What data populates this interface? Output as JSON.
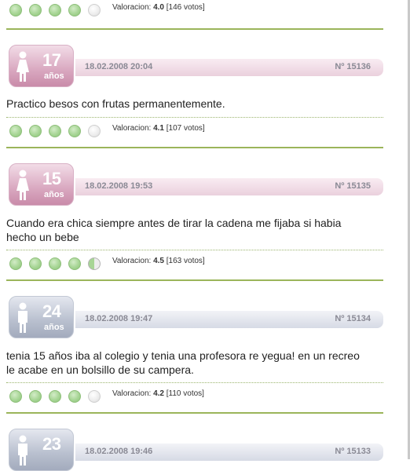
{
  "top_rating": {
    "dots": [
      "full",
      "full",
      "full",
      "full",
      "empty"
    ],
    "label": "Valoracion:",
    "score": "4.0",
    "votes": "[146 votos]"
  },
  "posts": [
    {
      "gender": "female",
      "age": "17",
      "age_unit": "años",
      "date": "18.02.2008 20:04",
      "number": "Nº 15136",
      "text": "Practico besos con frutas permanentemente.",
      "rating": {
        "dots": [
          "full",
          "full",
          "full",
          "full",
          "empty"
        ],
        "label": "Valoracion:",
        "score": "4.1",
        "votes": "[107 votos]"
      }
    },
    {
      "gender": "female",
      "age": "15",
      "age_unit": "años",
      "date": "18.02.2008 19:53",
      "number": "Nº 15135",
      "text_lines": [
        "Cuando era chica siempre antes de tirar la cadena me fijaba si habia",
        "hecho un bebe"
      ],
      "rating": {
        "dots": [
          "full",
          "full",
          "full",
          "full",
          "half"
        ],
        "label": "Valoracion:",
        "score": "4.5",
        "votes": "[163 votos]"
      }
    },
    {
      "gender": "male",
      "age": "24",
      "age_unit": "años",
      "date": "18.02.2008 19:47",
      "number": "Nº 15134",
      "text_lines": [
        "tenia 15 años iba al colegio y tenia una profesora re yegua! en un recreo",
        "le acabe en un bolsillo de su campera."
      ],
      "rating": {
        "dots": [
          "full",
          "full",
          "full",
          "full",
          "empty"
        ],
        "label": "Valoracion:",
        "score": "4.2",
        "votes": "[110 votos]"
      }
    },
    {
      "gender": "male",
      "age": "23",
      "date": "18.02.2008 19:46",
      "number": "Nº 15133"
    }
  ]
}
